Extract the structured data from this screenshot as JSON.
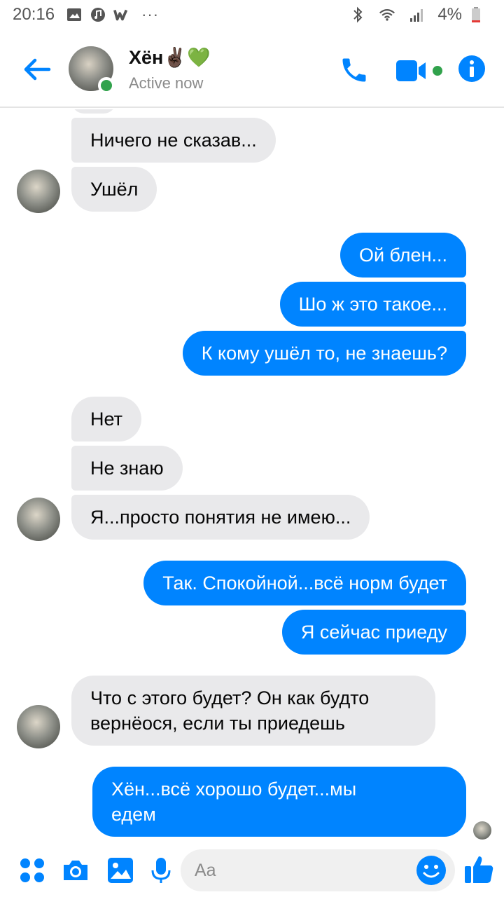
{
  "status_bar": {
    "time": "20:16",
    "dots": "···",
    "battery": "4%"
  },
  "header": {
    "contact_name": "Хён✌🏿💚",
    "status": "Active now"
  },
  "messages": [
    {
      "side": "in",
      "text": "Ничего не сказав..."
    },
    {
      "side": "in",
      "text": "Ушёл"
    },
    {
      "side": "out",
      "text": "Ой блен..."
    },
    {
      "side": "out",
      "text": "Шо ж это такое..."
    },
    {
      "side": "out",
      "text": "К кому ушёл то, не знаешь?"
    },
    {
      "side": "in",
      "text": "Нет"
    },
    {
      "side": "in",
      "text": "Не знаю"
    },
    {
      "side": "in",
      "text": "Я...просто понятия не имею..."
    },
    {
      "side": "out",
      "text": "Так. Спокойной...всё норм будет"
    },
    {
      "side": "out",
      "text": "Я сейчас приеду"
    },
    {
      "side": "in",
      "text": "Что с этого будет? Он как будто\nвернёося, если ты приедешь"
    },
    {
      "side": "out",
      "text": "Хён...всё хорошо будет...мы\nедем"
    }
  ],
  "composer": {
    "placeholder": "Aa"
  },
  "colors": {
    "accent": "#0084ff",
    "incoming_bubble": "#e9e9eb",
    "online": "#31a24c"
  },
  "icons": [
    "back-arrow-icon",
    "phone-icon",
    "video-camera-icon",
    "info-icon",
    "menu-dots-icon",
    "camera-icon",
    "gallery-icon",
    "microphone-icon",
    "emoji-icon",
    "thumbs-up-icon"
  ]
}
